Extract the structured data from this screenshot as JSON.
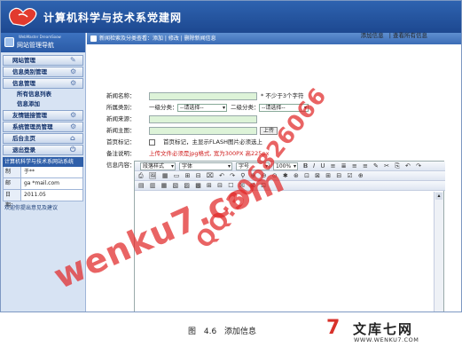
{
  "header": {
    "site_title": "计算机科学与技术系党建网"
  },
  "sidebar": {
    "banner_en": "WebMaster DreamSoow",
    "banner_cn": "网站管理导航",
    "menus": [
      {
        "label": "网站管理",
        "icon": "tools-icon"
      },
      {
        "label": "信息类别管理",
        "icon": "gear-icon"
      },
      {
        "label": "信息管理",
        "icon": "gear-icon"
      }
    ],
    "submenus": [
      "所有信息列表",
      "信息添加"
    ],
    "menus2": [
      {
        "label": "友情链接管理",
        "icon": "gear-icon"
      },
      {
        "label": "系统管理员管理",
        "icon": "gear-icon"
      },
      {
        "label": "后台主页",
        "icon": "home-icon"
      },
      {
        "label": "退出登录",
        "icon": "logout-icon"
      }
    ],
    "info_title": "计算机科学与技术系网站系统",
    "info_rows": [
      {
        "k": "制作：",
        "v": "于**"
      },
      {
        "k": "邮件：",
        "v": "ga    *mail.com"
      },
      {
        "k": "日期：",
        "v": "2011.05"
      }
    ],
    "feedback": "欢迎你提出意见及建议"
  },
  "content": {
    "titlebar": "新闻检索及分类查看：添加 | 修改 | 删除新闻信息",
    "links": [
      "添加信息",
      "| 查看所有信息"
    ],
    "form": {
      "news_name_label": "新闻名称：",
      "news_name_hint": "* 不少于3个字符",
      "category_label": "所属类别：",
      "cat1_prefix": "一级分类：",
      "cat1_value": "--请选择--",
      "cat2_prefix": "二级分类：",
      "cat2_value": "--请选择--",
      "source_label": "新闻来源：",
      "image_label": "新闻主图：",
      "upload_button": "上传",
      "flag_label": "首页标记：",
      "flag_text": "首页标记，主显示FLASH图片必须选上",
      "note_label": "备注说明：",
      "note_text": "上传文件必须是jpg格式, 宽为300PX 高225px",
      "body_label": "信息内容："
    },
    "editor": {
      "style_select": "段落样式",
      "font_select": "字体",
      "size_select": "字号",
      "zoom_select": "100%"
    }
  },
  "watermarks": [
    "wenku7.com",
    "QQ:306826066"
  ],
  "caption": "图 4.6   添加信息",
  "brand": {
    "mark": "7",
    "name": "文库七网",
    "url": "WWW.WENKU7.COM"
  }
}
